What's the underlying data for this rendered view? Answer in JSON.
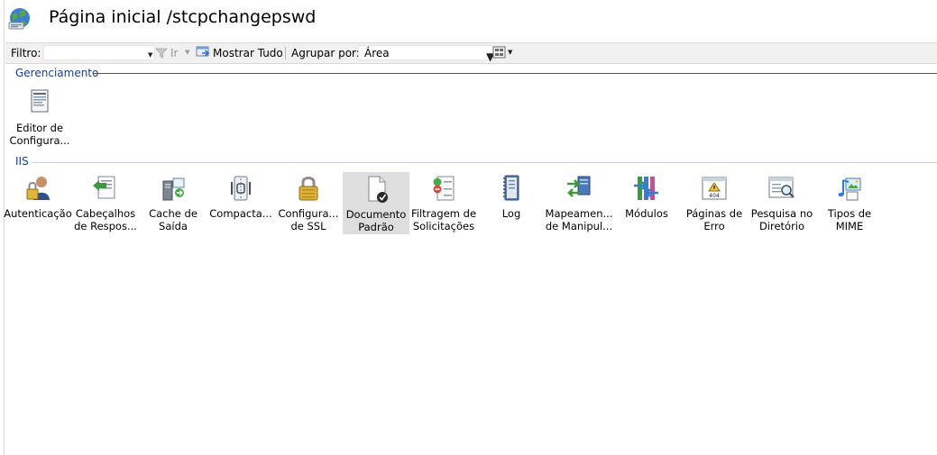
{
  "header": {
    "title": "Página inicial /stcpchangepswd",
    "icon": "globe-icon"
  },
  "toolbar": {
    "filter_label": "Filtro:",
    "filter_value": "",
    "go_label": "Ir",
    "show_all_label": "Mostrar Tudo",
    "group_by_label": "Agrupar por:",
    "group_by_value": "Área"
  },
  "sections": [
    {
      "name": "Gerenciamento",
      "items": [
        {
          "label": "Editor de\nConfigura...",
          "icon": "config-editor-icon"
        }
      ]
    },
    {
      "name": "IIS",
      "items": [
        {
          "label": "Autenticação",
          "icon": "authentication-icon"
        },
        {
          "label": "Cabeçalhos\nde Respos...",
          "icon": "response-headers-icon"
        },
        {
          "label": "Cache de\nSaída",
          "icon": "output-cache-icon"
        },
        {
          "label": "Compacta...",
          "icon": "compression-icon"
        },
        {
          "label": "Configura...\nde SSL",
          "icon": "ssl-icon"
        },
        {
          "label": "Documento\nPadrão",
          "icon": "default-document-icon",
          "selected": true
        },
        {
          "label": "Filtragem de\nSolicitações",
          "icon": "request-filtering-icon"
        },
        {
          "label": "Log",
          "icon": "log-icon"
        },
        {
          "label": "Mapeamen...\nde Manipul...",
          "icon": "handler-mappings-icon"
        },
        {
          "label": "Módulos",
          "icon": "modules-icon"
        },
        {
          "label": "Páginas de\nErro",
          "icon": "error-pages-icon"
        },
        {
          "label": "Pesquisa no\nDiretório",
          "icon": "directory-browsing-icon"
        },
        {
          "label": "Tipos de\nMIME",
          "icon": "mime-types-icon"
        }
      ]
    }
  ],
  "colors": {
    "section_header": "#1c3d8f",
    "selected_tile": "#dedede",
    "toolbar_bg": "#f0f0f0"
  }
}
